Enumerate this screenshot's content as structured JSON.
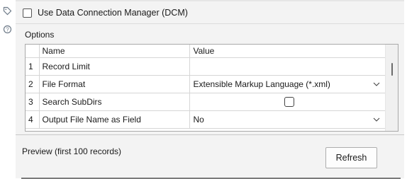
{
  "left_icons": [
    "tag-icon",
    "help-circle-icon"
  ],
  "dcm": {
    "label": "Use Data Connection Manager (DCM)",
    "checked": false
  },
  "options": {
    "title": "Options",
    "columns": {
      "name": "Name",
      "value": "Value"
    },
    "rows": [
      {
        "index": "1",
        "name": "Record Limit",
        "value": "",
        "kind": "text"
      },
      {
        "index": "2",
        "name": "File Format",
        "value": "Extensible Markup Language (*.xml)",
        "kind": "dropdown"
      },
      {
        "index": "3",
        "name": "Search SubDirs",
        "value": "",
        "kind": "checkbox",
        "checked": false
      },
      {
        "index": "4",
        "name": "Output File Name as Field",
        "value": "No",
        "kind": "dropdown"
      }
    ]
  },
  "preview": {
    "label": "Preview (first 100 records)",
    "refresh_label": "Refresh"
  }
}
